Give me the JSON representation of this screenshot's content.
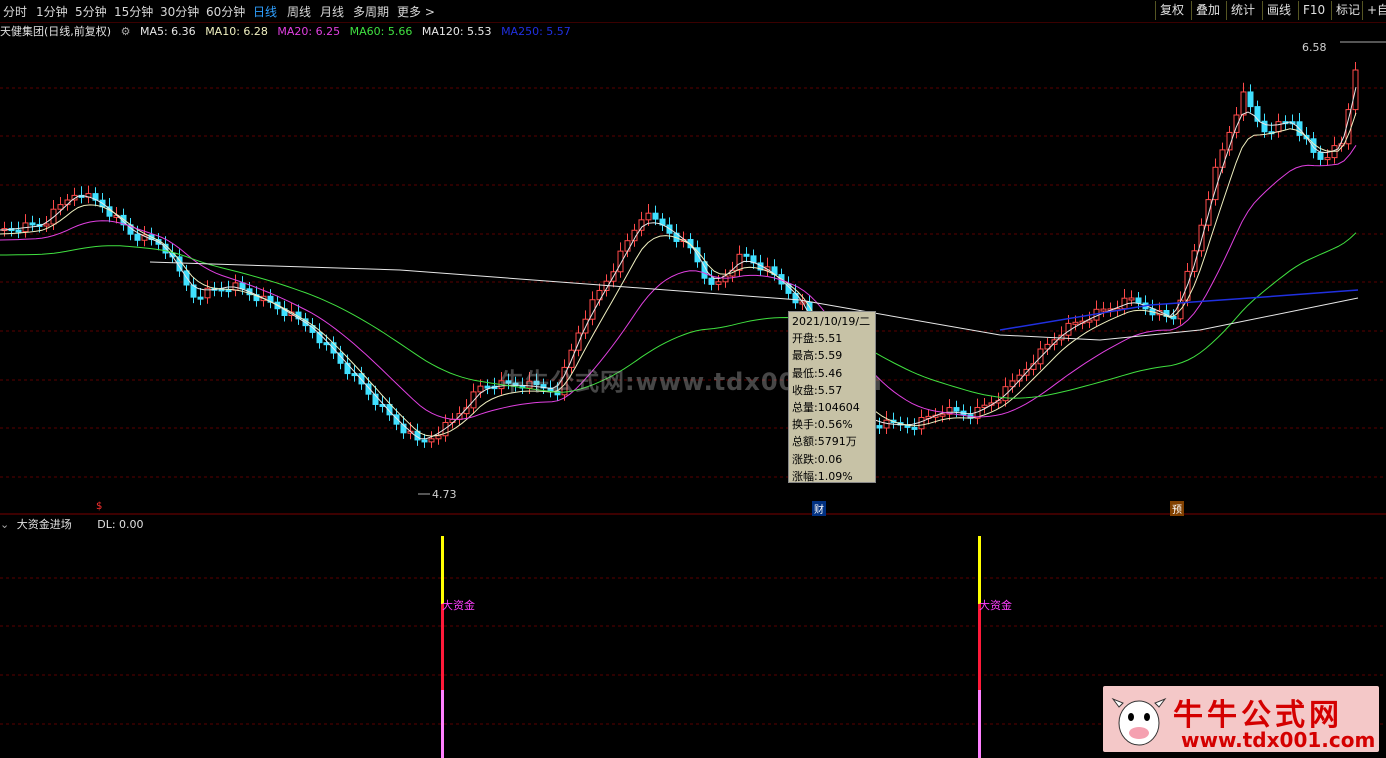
{
  "toolbar": {
    "periods": [
      "分时",
      "1分钟",
      "5分钟",
      "15分钟",
      "30分钟",
      "60分钟",
      "日线",
      "周线",
      "月线",
      "多周期",
      "更多 >"
    ],
    "active_period": "日线",
    "right_buttons": [
      "复权",
      "叠加",
      "统计",
      "画线",
      "F10",
      "标记",
      "+自"
    ]
  },
  "legend": {
    "title": "天健集团(日线,前复权)",
    "ma": [
      {
        "label": "MA5: 6.36",
        "color": "#e8e8e8"
      },
      {
        "label": "MA10: 6.28",
        "color": "#f0f0c0"
      },
      {
        "label": "MA20: 6.25",
        "color": "#e040e0"
      },
      {
        "label": "MA60: 5.66",
        "color": "#40e040"
      },
      {
        "label": "MA120: 5.53",
        "color": "#e8e8e8"
      },
      {
        "label": "MA250: 5.57",
        "color": "#2030e0"
      }
    ]
  },
  "price_labels": {
    "high": "6.58",
    "low": "4.73"
  },
  "tooltip": {
    "lines": [
      "2021/10/19/二",
      "开盘:5.51",
      "最高:5.59",
      "最低:5.46",
      "收盘:5.57",
      "总量:104604",
      "换手:0.56%",
      "总额:5791万",
      "涨跌:0.06",
      "涨幅:1.09%"
    ]
  },
  "markers": {
    "cai": "财",
    "yu": "预",
    "dollar": "$"
  },
  "indicator": {
    "name": "大资金进场",
    "value": "DL: 0.00",
    "tag": "大资金"
  },
  "watermark": "牛牛公式网:www.tdx001.com",
  "logo": {
    "title": "牛牛公式网",
    "url": "www.tdx001.com"
  },
  "chart_data": {
    "type": "candlestick",
    "ylim": [
      4.6,
      6.7
    ],
    "note_high": 6.58,
    "note_low": 4.73
  }
}
